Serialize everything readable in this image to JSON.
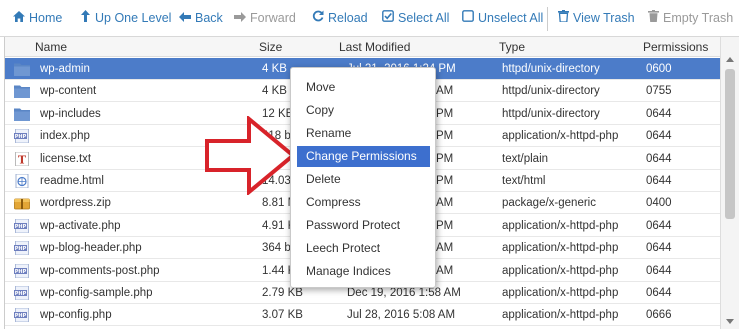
{
  "toolbar": {
    "home": "Home",
    "up_one_level": "Up One Level",
    "back": "Back",
    "forward": "Forward",
    "reload": "Reload",
    "select_all": "Select All",
    "unselect_all": "Unselect All",
    "view_trash": "View Trash",
    "empty_trash": "Empty Trash"
  },
  "columns": {
    "name": "Name",
    "size": "Size",
    "last_modified": "Last Modified",
    "type": "Type",
    "permissions": "Permissions"
  },
  "rows": [
    {
      "name": "wp-admin",
      "size": "4 KB",
      "modified": "Jul 21, 2016 1:24 PM",
      "type": "httpd/unix-directory",
      "perms": "0600",
      "icon": "folder-icon",
      "selected": true
    },
    {
      "name": "wp-content",
      "size": "4 KB",
      "modified": "",
      "type": "httpd/unix-directory",
      "perms": "0755",
      "icon": "folder-icon"
    },
    {
      "name": "wp-includes",
      "size": "12 KB",
      "modified": "",
      "type": "httpd/unix-directory",
      "perms": "0644",
      "icon": "folder-icon"
    },
    {
      "name": "index.php",
      "size": "418 b",
      "modified": "",
      "type": "application/x-httpd-php",
      "perms": "0644",
      "icon": "php-file-icon"
    },
    {
      "name": "license.txt",
      "size": "19.4",
      "modified": "",
      "type": "text/plain",
      "perms": "0644",
      "icon": "text-file-icon"
    },
    {
      "name": "readme.html",
      "size": "14.03",
      "modified": "",
      "type": "text/html",
      "perms": "0644",
      "icon": "html-file-icon"
    },
    {
      "name": "wordpress.zip",
      "size": "8.81 M",
      "modified": "",
      "type": "package/x-generic",
      "perms": "0400",
      "icon": "archive-file-icon"
    },
    {
      "name": "wp-activate.php",
      "size": "4.91 K",
      "modified": "",
      "type": "application/x-httpd-php",
      "perms": "0644",
      "icon": "php-file-icon"
    },
    {
      "name": "wp-blog-header.php",
      "size": "364 b",
      "modified": "",
      "type": "application/x-httpd-php",
      "perms": "0644",
      "icon": "php-file-icon"
    },
    {
      "name": "wp-comments-post.php",
      "size": "1.44 K",
      "modified": "",
      "type": "application/x-httpd-php",
      "perms": "0644",
      "icon": "php-file-icon"
    },
    {
      "name": "wp-config-sample.php",
      "size": "2.79 KB",
      "modified": "",
      "type": "application/x-httpd-php",
      "perms": "0644",
      "icon": "php-file-icon"
    },
    {
      "name": "wp-config.php",
      "size": "3.07 KB",
      "modified": "Jul 28, 2016 5:08 AM",
      "type": "application/x-httpd-php",
      "perms": "0666",
      "icon": "php-file-icon"
    }
  ],
  "context_menu": {
    "items": [
      "Move",
      "Copy",
      "Rename",
      "Change Permissions",
      "Delete",
      "Compress",
      "Password Protect",
      "Leech Protect",
      "Manage Indices"
    ],
    "active_index": 3
  },
  "partial_timestamps": {
    "row0": [
      "PM"
    ],
    "row1": [
      "AM"
    ],
    "row2": [
      "PM"
    ],
    "row3": [
      "PM"
    ],
    "row4": [
      "PM"
    ],
    "row5": [
      "PM"
    ],
    "row6": [
      "AM"
    ],
    "row7": [
      "PM"
    ],
    "row8": [
      "AM"
    ],
    "row9": [
      "AM"
    ],
    "row10": [
      "Dec 19, 2016 1:58 AM"
    ]
  },
  "colors": {
    "link_blue": "#337ab7",
    "selection_blue": "#4c7cc9",
    "menu_highlight": "#3d6fce",
    "annotation_red": "#d8232a",
    "folder_blue": "#5a86c5"
  }
}
